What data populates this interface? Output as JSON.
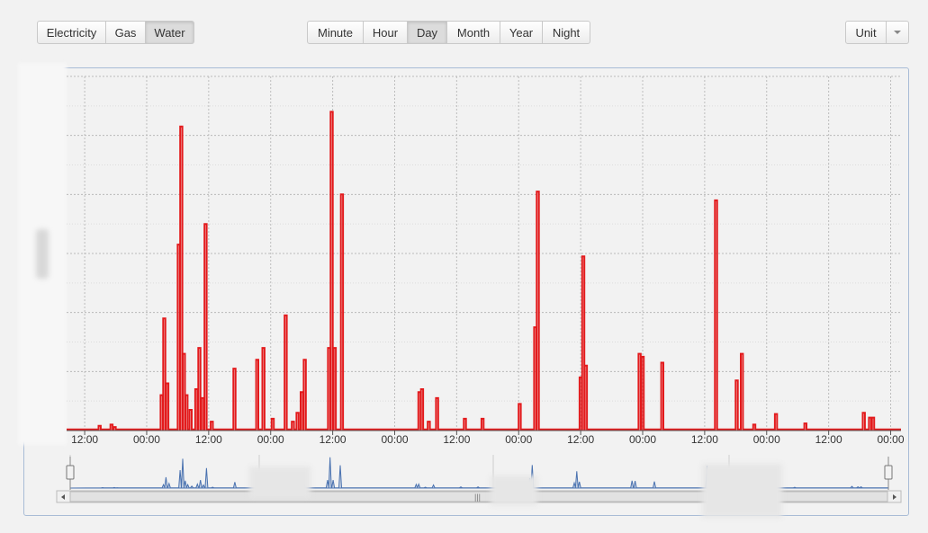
{
  "toolbar": {
    "type_buttons": [
      "Electricity",
      "Gas",
      "Water"
    ],
    "type_active": "Water",
    "period_buttons": [
      "Minute",
      "Hour",
      "Day",
      "Month",
      "Year",
      "Night"
    ],
    "period_active": "Day",
    "unit_label": "Unit"
  },
  "colors": {
    "series": "#e31a1c",
    "navigator": "#4a72b0",
    "frame": "#a9bcd6"
  },
  "chart_data": {
    "type": "line",
    "title": "",
    "xlabel": "",
    "ylabel": "",
    "x_tick_labels": [
      "12:00",
      "00:00",
      "12:00",
      "00:00",
      "12:00",
      "00:00",
      "12:00",
      "00:00",
      "12:00",
      "00:00",
      "12:00",
      "00:00",
      "12:00",
      "00:00"
    ],
    "x_range_hours": [
      -3.5,
      158
    ],
    "ylim": [
      0,
      6
    ],
    "grid": true,
    "legend": "none",
    "series": [
      {
        "values_note": "relative flow level (y axis labels not shown)",
        "spikes": [
          {
            "t": 2.9,
            "v": 0.08
          },
          {
            "t": 5.2,
            "v": 0.1
          },
          {
            "t": 5.8,
            "v": 0.06
          },
          {
            "t": 14.9,
            "v": 0.6
          },
          {
            "t": 15.4,
            "v": 1.9
          },
          {
            "t": 16.0,
            "v": 0.8
          },
          {
            "t": 18.2,
            "v": 3.15
          },
          {
            "t": 18.7,
            "v": 5.15
          },
          {
            "t": 19.2,
            "v": 1.3
          },
          {
            "t": 19.7,
            "v": 0.6
          },
          {
            "t": 20.5,
            "v": 0.35
          },
          {
            "t": 21.6,
            "v": 0.7
          },
          {
            "t": 22.2,
            "v": 1.4
          },
          {
            "t": 22.8,
            "v": 0.55
          },
          {
            "t": 23.4,
            "v": 3.5
          },
          {
            "t": 24.6,
            "v": 0.15
          },
          {
            "t": 29.0,
            "v": 1.05
          },
          {
            "t": 33.4,
            "v": 1.2
          },
          {
            "t": 34.6,
            "v": 1.4
          },
          {
            "t": 36.4,
            "v": 0.2
          },
          {
            "t": 38.9,
            "v": 1.95
          },
          {
            "t": 40.3,
            "v": 0.15
          },
          {
            "t": 41.2,
            "v": 0.3
          },
          {
            "t": 42.0,
            "v": 0.65
          },
          {
            "t": 42.6,
            "v": 1.2
          },
          {
            "t": 47.3,
            "v": 1.4
          },
          {
            "t": 47.8,
            "v": 5.4
          },
          {
            "t": 48.4,
            "v": 1.4
          },
          {
            "t": 49.8,
            "v": 4.0
          },
          {
            "t": 64.8,
            "v": 0.65
          },
          {
            "t": 65.3,
            "v": 0.7
          },
          {
            "t": 66.6,
            "v": 0.15
          },
          {
            "t": 68.2,
            "v": 0.55
          },
          {
            "t": 73.6,
            "v": 0.2
          },
          {
            "t": 77.0,
            "v": 0.2
          },
          {
            "t": 84.2,
            "v": 0.45
          },
          {
            "t": 87.2,
            "v": 1.75
          },
          {
            "t": 87.7,
            "v": 4.05
          },
          {
            "t": 96.0,
            "v": 0.9
          },
          {
            "t": 96.5,
            "v": 2.95
          },
          {
            "t": 97.0,
            "v": 1.1
          },
          {
            "t": 107.4,
            "v": 1.3
          },
          {
            "t": 108.0,
            "v": 1.25
          },
          {
            "t": 111.8,
            "v": 1.15
          },
          {
            "t": 122.2,
            "v": 3.9
          },
          {
            "t": 126.2,
            "v": 0.85
          },
          {
            "t": 127.2,
            "v": 1.3
          },
          {
            "t": 129.6,
            "v": 0.1
          },
          {
            "t": 133.8,
            "v": 0.28
          },
          {
            "t": 139.5,
            "v": 0.12
          },
          {
            "t": 150.8,
            "v": 0.3
          },
          {
            "t": 152.0,
            "v": 0.22
          },
          {
            "t": 152.6,
            "v": 0.22
          }
        ]
      }
    ]
  }
}
